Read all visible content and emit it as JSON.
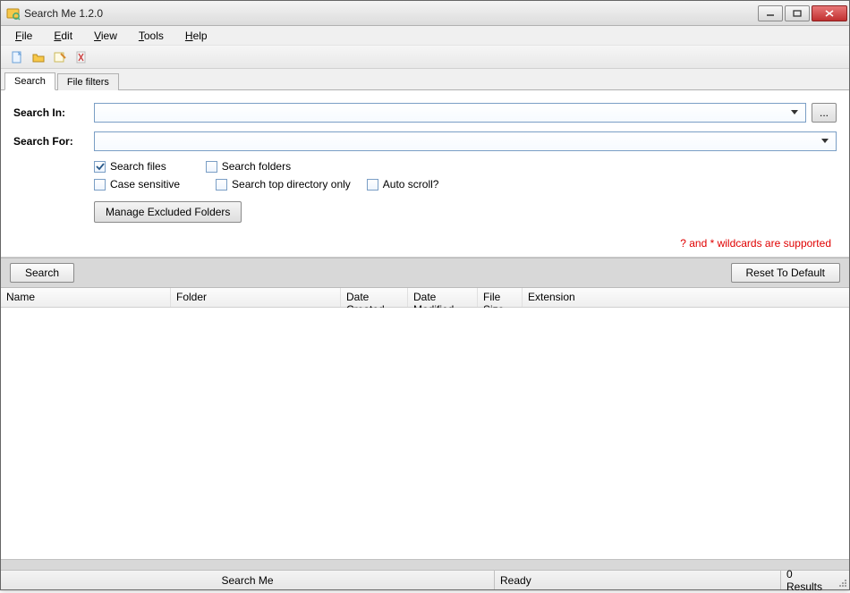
{
  "window": {
    "title": "Search Me 1.2.0"
  },
  "menu": {
    "file": "File",
    "edit": "Edit",
    "view": "View",
    "tools": "Tools",
    "help": "Help"
  },
  "tabs": {
    "search": "Search",
    "file_filters": "File filters"
  },
  "form": {
    "search_in_label": "Search In:",
    "search_in_value": "",
    "search_for_label": "Search For:",
    "search_for_value": "",
    "browse_label": "..."
  },
  "options": {
    "search_files": {
      "label": "Search files",
      "checked": true
    },
    "search_folders": {
      "label": "Search folders",
      "checked": false
    },
    "case_sensitive": {
      "label": "Case sensitive",
      "checked": false
    },
    "search_top_only": {
      "label": "Search top directory only",
      "checked": false
    },
    "auto_scroll": {
      "label": "Auto scroll?",
      "checked": false
    }
  },
  "buttons": {
    "manage_excluded": "Manage Excluded Folders",
    "search": "Search",
    "reset_default": "Reset To Default"
  },
  "hint": "? and * wildcards are supported",
  "columns": {
    "name": "Name",
    "folder": "Folder",
    "date_created": "Date Created",
    "date_modified": "Date Modified",
    "file_size": "File Size",
    "extension": "Extension"
  },
  "status": {
    "app": "Search Me",
    "state": "Ready",
    "results": "0 Results"
  }
}
